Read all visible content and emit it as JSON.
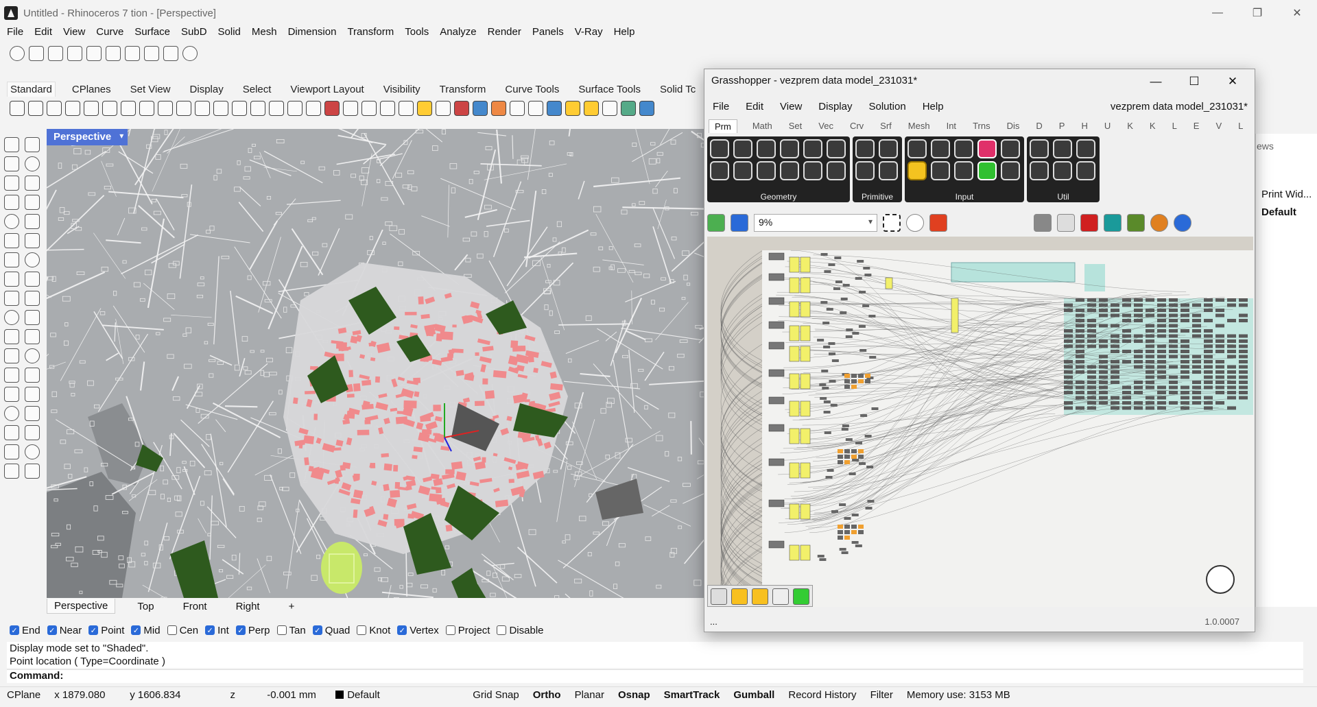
{
  "rhino": {
    "title": "Untitled - Rhinoceros 7 tion - [Perspective]",
    "window_controls": {
      "minimize": "—",
      "restore": "❐",
      "close": "✕"
    },
    "menu": [
      "File",
      "Edit",
      "View",
      "Curve",
      "Surface",
      "SubD",
      "Solid",
      "Mesh",
      "Dimension",
      "Transform",
      "Tools",
      "Analyze",
      "Render",
      "Panels",
      "V-Ray",
      "Help"
    ],
    "toolbar_tabs": [
      "Standard",
      "CPlanes",
      "Set View",
      "Display",
      "Select",
      "Viewport Layout",
      "Visibility",
      "Transform",
      "Curve Tools",
      "Surface Tools",
      "Solid Tc"
    ],
    "viewport": {
      "label": "Perspective",
      "tabs": [
        "Perspective",
        "Top",
        "Front",
        "Right",
        "+"
      ]
    },
    "osnaps": [
      {
        "label": "End",
        "checked": true
      },
      {
        "label": "Near",
        "checked": true
      },
      {
        "label": "Point",
        "checked": true
      },
      {
        "label": "Mid",
        "checked": true
      },
      {
        "label": "Cen",
        "checked": false
      },
      {
        "label": "Int",
        "checked": true
      },
      {
        "label": "Perp",
        "checked": true
      },
      {
        "label": "Tan",
        "checked": false
      },
      {
        "label": "Quad",
        "checked": true
      },
      {
        "label": "Knot",
        "checked": false
      },
      {
        "label": "Vertex",
        "checked": true
      },
      {
        "label": "Project",
        "checked": false
      },
      {
        "label": "Disable",
        "checked": false
      }
    ],
    "command_history": [
      "Display mode set to \"Shaded\".",
      "Point location ( Type=Coordinate )"
    ],
    "command_prompt": "Command:",
    "status": {
      "cplane": "CPlane",
      "x": "x 1879.080",
      "y": "y 1606.834",
      "z": "z",
      "units": "-0.001 mm",
      "layer": "Default",
      "toggles": [
        {
          "label": "Grid Snap",
          "bold": false
        },
        {
          "label": "Ortho",
          "bold": true
        },
        {
          "label": "Planar",
          "bold": false
        },
        {
          "label": "Osnap",
          "bold": true
        },
        {
          "label": "SmartTrack",
          "bold": true
        },
        {
          "label": "Gumball",
          "bold": true
        },
        {
          "label": "Record History",
          "bold": false
        },
        {
          "label": "Filter",
          "bold": false
        }
      ],
      "memory": "Memory use: 3153 MB"
    },
    "side_panel": {
      "tab_hint": "ews",
      "item1": "Print Wid...",
      "item2": "Default"
    }
  },
  "grasshopper": {
    "title": "Grasshopper - vezprem data model_231031*",
    "window_controls": {
      "minimize": "—",
      "maximize": "☐",
      "close": "✕"
    },
    "menu": [
      "File",
      "Edit",
      "View",
      "Display",
      "Solution",
      "Help"
    ],
    "document_name": "vezprem data model_231031*",
    "tabs": [
      "Prm",
      "Math",
      "Set",
      "Vec",
      "Crv",
      "Srf",
      "Mesh",
      "Int",
      "Trns",
      "Dis",
      "D",
      "P",
      "H",
      "U",
      "K",
      "K",
      "L",
      "E",
      "V",
      "L"
    ],
    "groups": [
      {
        "name": "Geometry",
        "cols": 6
      },
      {
        "name": "Primitive",
        "cols": 2
      },
      {
        "name": "Input",
        "cols": 5
      },
      {
        "name": "Util",
        "cols": 3
      }
    ],
    "zoom": "9%",
    "status_left": "...",
    "version": "1.0.0007"
  },
  "colors": {
    "viewport_bg": "#a9acaf",
    "building_pink": "#f08a8c",
    "park_green": "#2e5a1e",
    "gh_canvas": "#d4d0c8",
    "gh_component_yellow": "#f2f06a",
    "gh_component_teal": "#b7e3dc"
  }
}
